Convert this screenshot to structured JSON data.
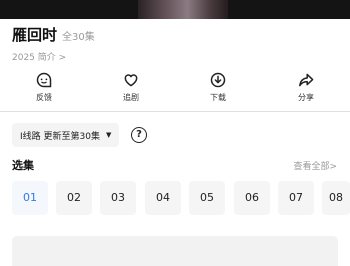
{
  "show": {
    "title": "雁回时",
    "episode_total": "全30集",
    "meta": "2025 简介 >"
  },
  "actions": [
    {
      "label": "反馈",
      "icon": "feedback-icon"
    },
    {
      "label": "追剧",
      "icon": "heart-icon"
    },
    {
      "label": "下载",
      "icon": "download-icon"
    },
    {
      "label": "分享",
      "icon": "share-icon"
    }
  ],
  "source": {
    "line_label": "I线路 更新至第30集",
    "caret": "▼",
    "help_icon": "?"
  },
  "episodes_section": {
    "title": "选集",
    "view_all": "查看全部>",
    "items": [
      "01",
      "02",
      "03",
      "04",
      "05",
      "06",
      "07",
      "08"
    ],
    "selected": "01"
  },
  "colors": {
    "accent": "#2f7be6",
    "tile_bg": "#f5f5f5",
    "muted_text": "#999999"
  }
}
